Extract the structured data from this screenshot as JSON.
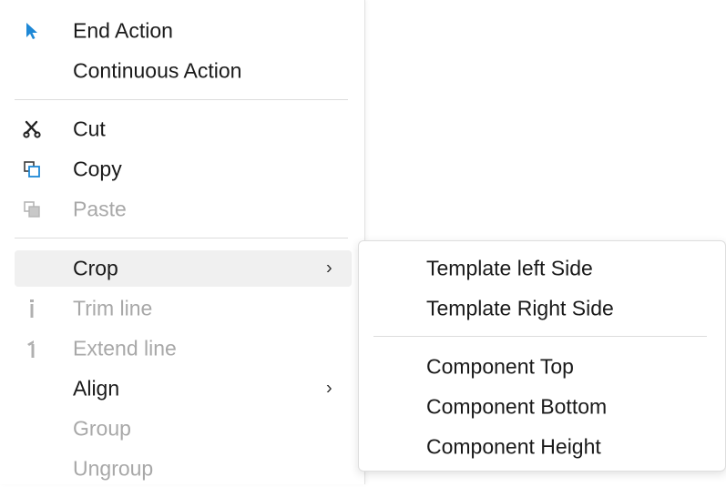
{
  "menu": {
    "items": [
      {
        "label": "End Action",
        "icon": "cursor-arrow-icon",
        "enabled": true
      },
      {
        "label": "Continuous Action",
        "icon": "",
        "enabled": true
      },
      {
        "label": "Cut",
        "icon": "scissors-icon",
        "enabled": true
      },
      {
        "label": "Copy",
        "icon": "copy-icon",
        "enabled": true
      },
      {
        "label": "Paste",
        "icon": "paste-icon",
        "enabled": false
      },
      {
        "label": "Crop",
        "icon": "",
        "enabled": true,
        "submenu": true,
        "chevron": "›"
      },
      {
        "label": "Trim line",
        "icon": "trim-line-icon",
        "enabled": false
      },
      {
        "label": "Extend line",
        "icon": "extend-line-icon",
        "enabled": false
      },
      {
        "label": "Align",
        "icon": "",
        "enabled": true,
        "submenu": true,
        "chevron": "›"
      },
      {
        "label": "Group",
        "icon": "",
        "enabled": false
      },
      {
        "label": "Ungroup",
        "icon": "",
        "enabled": false
      }
    ]
  },
  "submenu": {
    "parent": "Crop",
    "items": [
      {
        "label": "Template left Side"
      },
      {
        "label": "Template Right Side"
      },
      {
        "label": "Component Top"
      },
      {
        "label": "Component Bottom"
      },
      {
        "label": "Component Height"
      }
    ]
  },
  "colors": {
    "accent": "#1e88d6",
    "text": "#1a1a1a",
    "disabled_text": "#a8a8a8",
    "hover_bg": "#f0f0f0"
  }
}
